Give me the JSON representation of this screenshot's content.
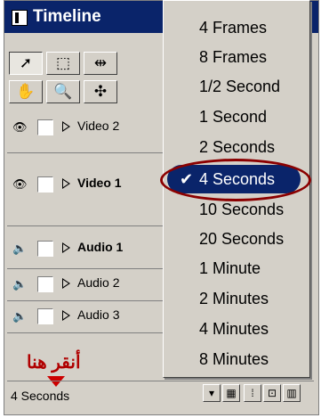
{
  "window": {
    "title": "Timeline"
  },
  "toolbox": {
    "tools": [
      {
        "name": "selection-tool",
        "glyph": "➚",
        "pressed": true
      },
      {
        "name": "marquee-tool",
        "glyph": "⬚",
        "pressed": false
      },
      {
        "name": "track-select-tool",
        "glyph": "⇹",
        "pressed": false
      },
      {
        "name": "hand-tool",
        "glyph": "✋",
        "pressed": false
      },
      {
        "name": "zoom-tool",
        "glyph": "🔍",
        "pressed": false
      },
      {
        "name": "link-tool",
        "glyph": "✣",
        "pressed": false
      }
    ]
  },
  "tracks": [
    {
      "label": "Video 2",
      "type": "video",
      "bold": false
    },
    {
      "label": "Video 1",
      "type": "video",
      "bold": true
    },
    {
      "label": "Audio 1",
      "type": "audio",
      "bold": true
    },
    {
      "label": "Audio 2",
      "type": "audio",
      "bold": false
    },
    {
      "label": "Audio 3",
      "type": "audio",
      "bold": false
    }
  ],
  "bottom": {
    "time_unit_label": "4 Seconds",
    "annotation_text": "أنقر هنا"
  },
  "menu": {
    "items": [
      "4 Frames",
      "8 Frames",
      "1/2 Second",
      "1 Second",
      "2 Seconds",
      "4 Seconds",
      "10 Seconds",
      "20 Seconds",
      "1 Minute",
      "2 Minutes",
      "4 Minutes",
      "8 Minutes"
    ],
    "selected_index": 5,
    "check_glyph": "✔"
  },
  "colors": {
    "selection": "#0a246a",
    "annotation": "#b00000",
    "highlight_ring": "#8b0000"
  }
}
